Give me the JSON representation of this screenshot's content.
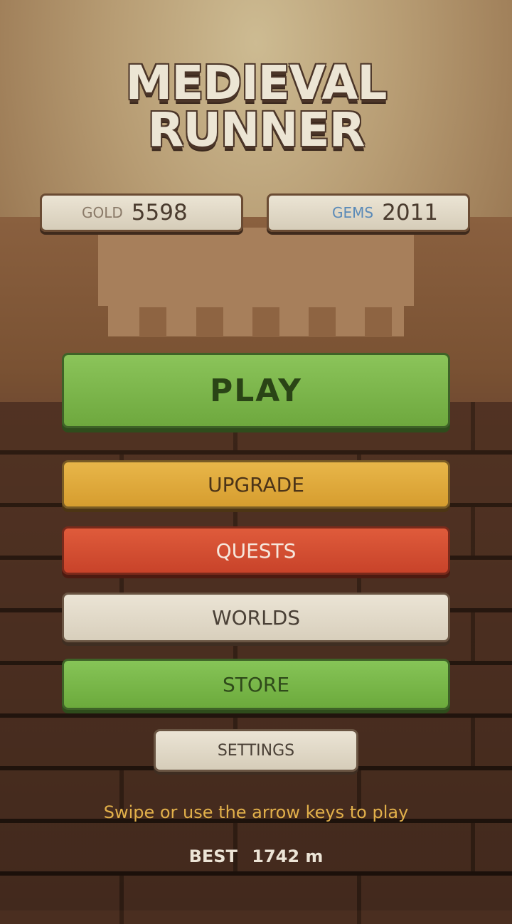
{
  "title": {
    "line1": "MEDIEVAL",
    "line2": "RUNNER"
  },
  "stats": {
    "gold": {
      "label": "GOLD",
      "value": "5598",
      "label_color": "#8a7a68"
    },
    "gems": {
      "label": "GEMS",
      "value": "2011",
      "label_color": "#5a8ab8"
    }
  },
  "menu": {
    "play": "PLAY",
    "upgrade": "UPGRADE",
    "quests": "QUESTS",
    "worlds": "WORLDS",
    "store": "STORE",
    "settings": "SETTINGS"
  },
  "hint": "Swipe or use the arrow keys to play",
  "best": {
    "label": "BEST",
    "value": "1742 m"
  },
  "colors": {
    "play": "#7ab64a",
    "upgrade": "#e0aa3c",
    "quests": "#d44f34",
    "worlds": "#e2dac8",
    "store": "#78b748",
    "hint": "#e2b04a"
  }
}
